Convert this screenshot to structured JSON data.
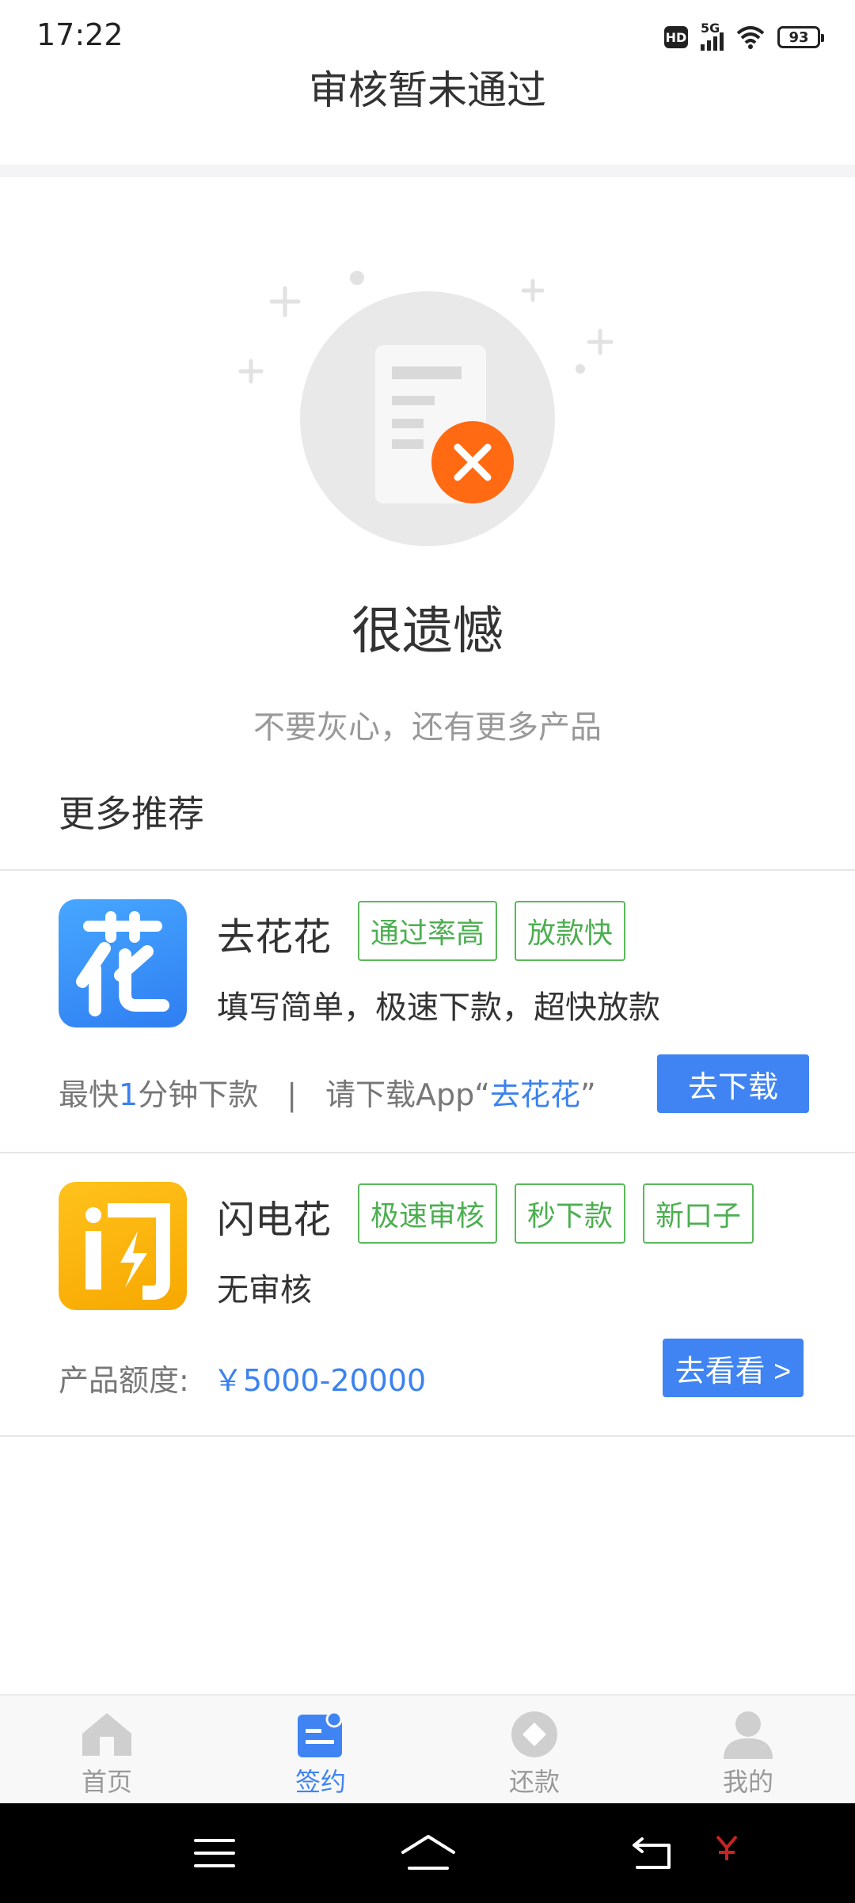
{
  "status_bar": {
    "time": "17:22",
    "hd": "HD",
    "network": "5G",
    "battery": "93"
  },
  "header": {
    "title": "审核暂未通过"
  },
  "result": {
    "title": "很遗憾",
    "subtitle": "不要灰心，还有更多产品"
  },
  "section_title": "更多推荐",
  "products": [
    {
      "name": "去花花",
      "logo_char": "花",
      "tags": [
        "通过率高",
        "放款快"
      ],
      "desc": "填写简单，极速下款，超快放款",
      "meta_prefix": "最快",
      "meta_highlight": "1",
      "meta_suffix": "分钟下款",
      "meta_separator": "|",
      "meta_download_prefix": "请下载App“",
      "meta_download_name": "去花花",
      "meta_download_suffix": "”",
      "button": "去下载"
    },
    {
      "name": "闪电花",
      "logo_char": "闪",
      "tags": [
        "极速审核",
        "秒下款",
        "新口子"
      ],
      "desc": "无审核",
      "meta_label": "产品额度:",
      "meta_amount": "￥5000-20000",
      "button": "去看看 >"
    }
  ],
  "tabbar": [
    {
      "label": "首页",
      "icon": "home-icon",
      "active": false
    },
    {
      "label": "签约",
      "icon": "contract-icon",
      "active": true
    },
    {
      "label": "还款",
      "icon": "repay-icon",
      "active": false
    },
    {
      "label": "我的",
      "icon": "profile-icon",
      "active": false
    }
  ],
  "colors": {
    "accent": "#3f84f2",
    "tag_green": "#4caf50",
    "error_orange": "#ff6a13"
  }
}
